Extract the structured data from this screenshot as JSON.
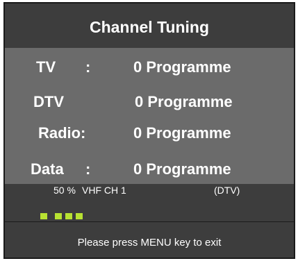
{
  "dialog": {
    "title": "Channel Tuning"
  },
  "rows": [
    {
      "label": "TV",
      "sep": ":",
      "value": "0 Programme"
    },
    {
      "label": "DTV",
      "sep": "",
      "value": "0 Programme"
    },
    {
      "label": "Radio",
      "sep": ":",
      "value": "0 Programme"
    },
    {
      "label": "Data",
      "sep": ":",
      "value": "0 Programme"
    }
  ],
  "status": {
    "percent": "50 %",
    "band_channel": "VHF CH 1",
    "mode": "(DTV)",
    "progress_fraction": 0.5,
    "accent_color": "#b8e232"
  },
  "footer": {
    "hint": "Please press MENU key to exit"
  }
}
